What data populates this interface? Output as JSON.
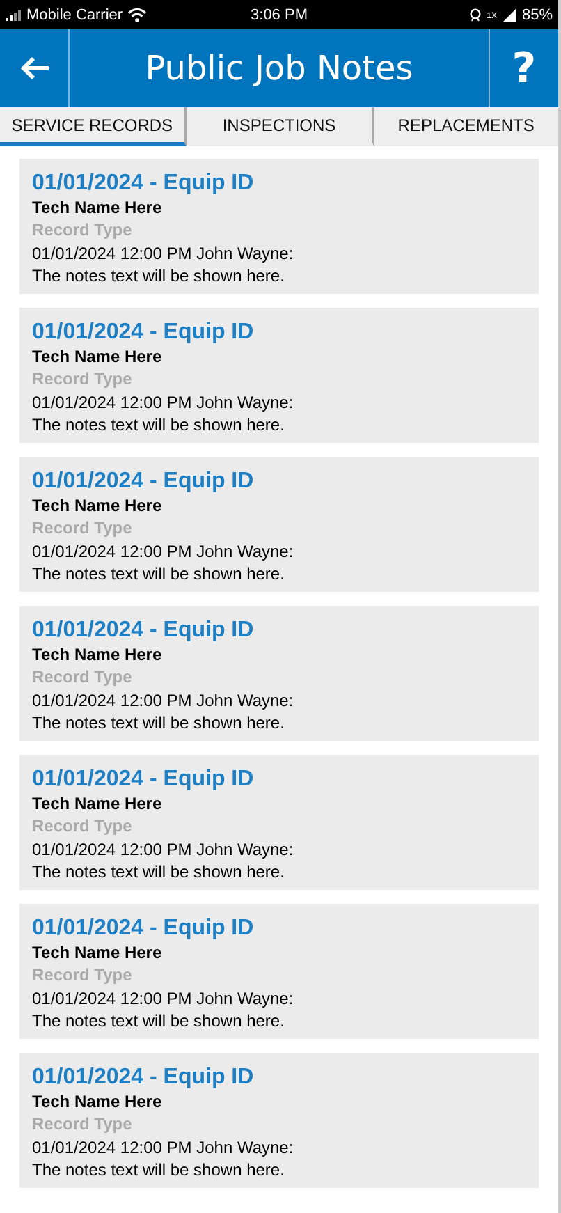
{
  "status_bar": {
    "carrier": "Mobile Carrier",
    "time": "3:06 PM",
    "network": "1X",
    "battery": "85%"
  },
  "header": {
    "title": "Public Job Notes",
    "help": "?"
  },
  "tabs": [
    {
      "label": "SERVICE RECORDS",
      "selected": true
    },
    {
      "label": "INSPECTIONS",
      "selected": false
    },
    {
      "label": "REPLACEMENTS",
      "selected": false
    }
  ],
  "records": [
    {
      "title": "01/01/2024 - Equip ID",
      "tech": "Tech Name Here",
      "type": "Record Type",
      "entry": "01/01/2024 12:00 PM John Wayne:",
      "note": "The notes text will be shown here."
    },
    {
      "title": "01/01/2024 - Equip ID",
      "tech": "Tech Name Here",
      "type": "Record Type",
      "entry": "01/01/2024 12:00 PM John Wayne:",
      "note": "The notes text will be shown here."
    },
    {
      "title": "01/01/2024 - Equip ID",
      "tech": "Tech Name Here",
      "type": "Record Type",
      "entry": "01/01/2024 12:00 PM John Wayne:",
      "note": "The notes text will be shown here."
    },
    {
      "title": "01/01/2024 - Equip ID",
      "tech": "Tech Name Here",
      "type": "Record Type",
      "entry": "01/01/2024 12:00 PM John Wayne:",
      "note": "The notes text will be shown here."
    },
    {
      "title": "01/01/2024 - Equip ID",
      "tech": "Tech Name Here",
      "type": "Record Type",
      "entry": "01/01/2024 12:00 PM John Wayne:",
      "note": "The notes text will be shown here."
    },
    {
      "title": "01/01/2024 - Equip ID",
      "tech": "Tech Name Here",
      "type": "Record Type",
      "entry": "01/01/2024 12:00 PM John Wayne:",
      "note": "The notes text will be shown here."
    },
    {
      "title": "01/01/2024 - Equip ID",
      "tech": "Tech Name Here",
      "type": "Record Type",
      "entry": "01/01/2024 12:00 PM John Wayne:",
      "note": "The notes text will be shown here."
    }
  ]
}
